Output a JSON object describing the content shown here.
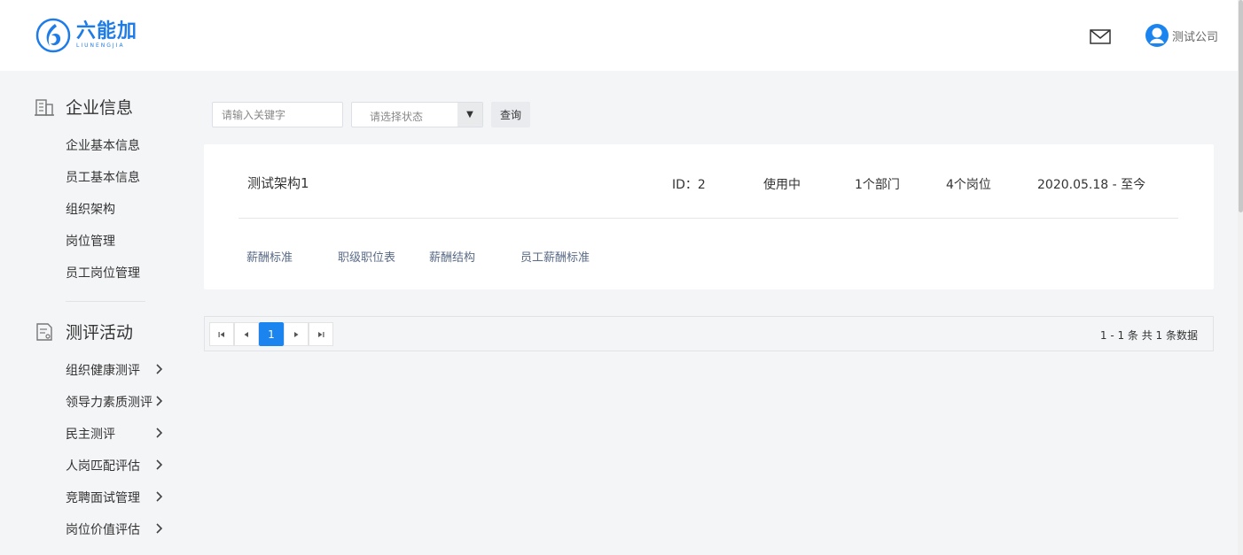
{
  "header": {
    "logo_cn": "六能加",
    "logo_en": "LIUNENGJIA",
    "user_name": "测试公司"
  },
  "sidebar": {
    "section1": {
      "title": "企业信息",
      "items": [
        "企业基本信息",
        "员工基本信息",
        "组织架构",
        "岗位管理",
        "员工岗位管理"
      ]
    },
    "section2": {
      "title": "测评活动",
      "items": [
        "组织健康测评",
        "领导力素质测评",
        "民主测评",
        "人岗匹配评估",
        "竞聘面试管理",
        "岗位价值评估"
      ]
    }
  },
  "toolbar": {
    "keyword_placeholder": "请输入关键字",
    "status_placeholder": "请选择状态",
    "query_label": "查询"
  },
  "card": {
    "name": "测试架构1",
    "id": "ID：2",
    "status": "使用中",
    "departments": "1个部门",
    "positions": "4个岗位",
    "period": "2020.05.18 - 至今",
    "links": [
      "薪酬标准",
      "职级职位表",
      "薪酬结构",
      "员工薪酬标准"
    ]
  },
  "pagination": {
    "current_page": "1",
    "info": "1 - 1 条   共 1 条数据"
  },
  "colors": {
    "brand": "#1e7ce8",
    "active_page": "#1c84ee",
    "link": "#5a6b87",
    "background": "#f4f5f7"
  },
  "icons": [
    "logo-icon",
    "mail-icon",
    "avatar-icon",
    "building-icon",
    "survey-icon",
    "chevron-right-icon",
    "first-page-icon",
    "prev-page-icon",
    "next-page-icon",
    "last-page-icon",
    "dropdown-arrow-icon"
  ]
}
